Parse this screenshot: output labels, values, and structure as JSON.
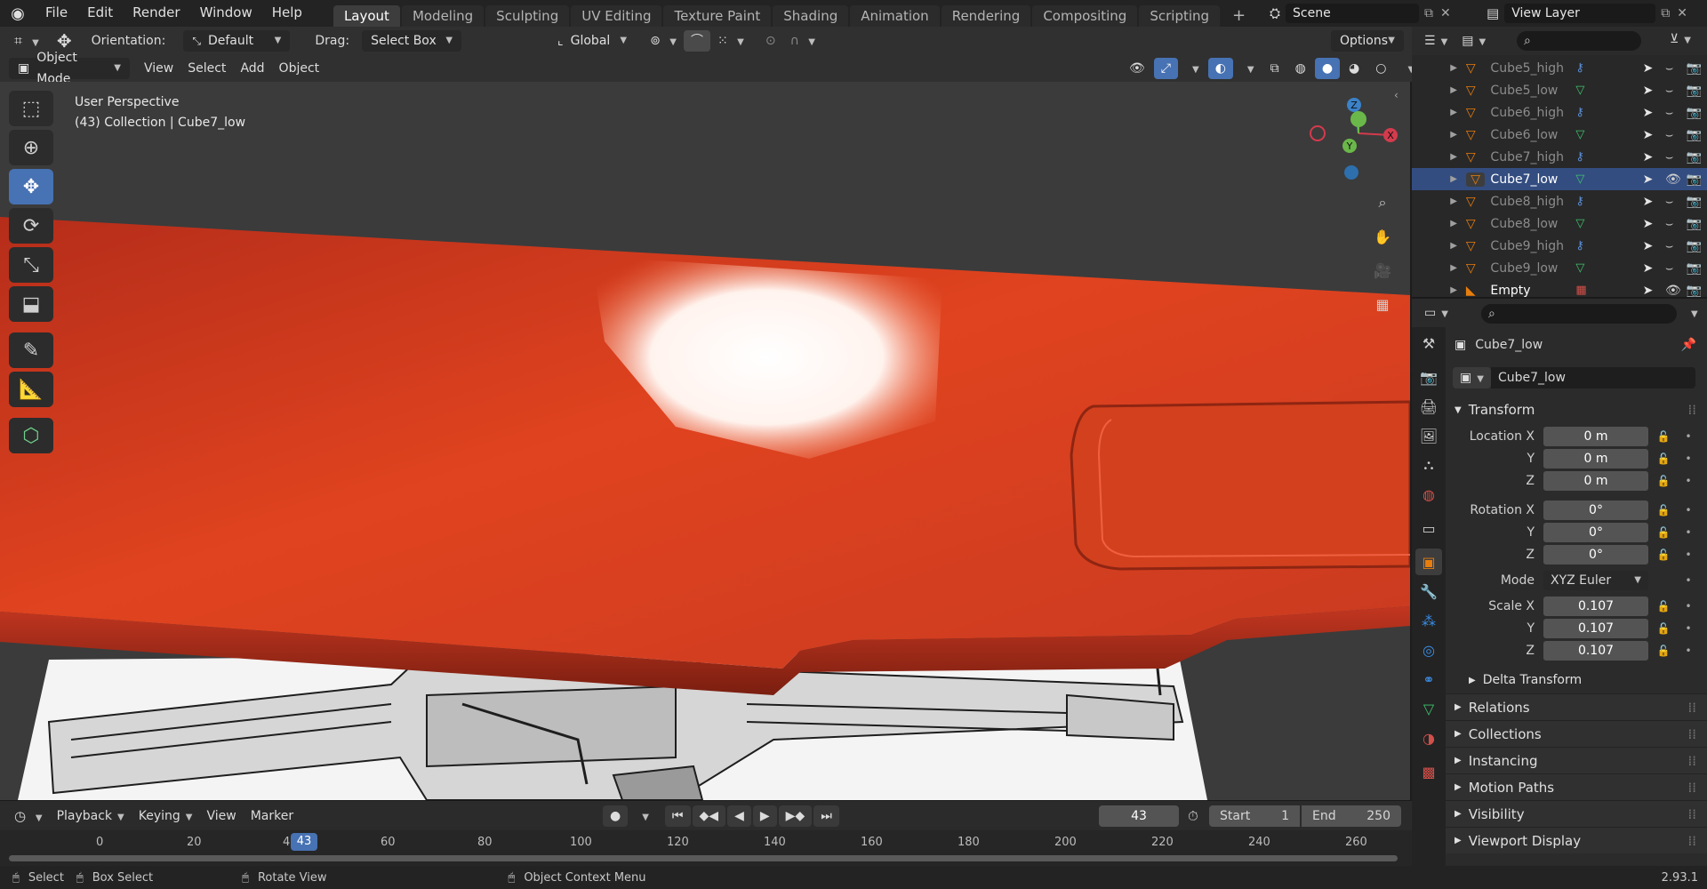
{
  "topbar": {
    "menus": [
      "File",
      "Edit",
      "Render",
      "Window",
      "Help"
    ],
    "workspaces": [
      "Layout",
      "Modeling",
      "Sculpting",
      "UV Editing",
      "Texture Paint",
      "Shading",
      "Animation",
      "Rendering",
      "Compositing",
      "Scripting"
    ],
    "active_workspace": "Layout",
    "add_tab": "+",
    "scene": "Scene",
    "view_layer": "View Layer"
  },
  "viewport_header": {
    "orientation_label": "Orientation:",
    "orientation_value": "Default",
    "drag_label": "Drag:",
    "drag_value": "Select Box",
    "transform_space": "Global",
    "options": "Options",
    "mode": "Object Mode",
    "menus": [
      "View",
      "Select",
      "Add",
      "Object"
    ]
  },
  "viewport": {
    "perspective": "User Perspective",
    "collection_info": "(43) Collection | Cube7_low",
    "gizmo_axes": [
      "Z",
      "Y",
      "X"
    ]
  },
  "timeline": {
    "menus": [
      "Playback",
      "Keying",
      "View",
      "Marker"
    ],
    "current_frame": "43",
    "start_label": "Start",
    "start": "1",
    "end_label": "End",
    "end": "250",
    "ticks": [
      "0",
      "20",
      "4",
      "60",
      "80",
      "100",
      "120",
      "140",
      "160",
      "180",
      "200",
      "220",
      "240",
      "260"
    ],
    "playhead": "43"
  },
  "statusbar": {
    "items": [
      "Select",
      "Box Select",
      "Rotate View",
      "Object Context Menu"
    ],
    "version": "2.93.1"
  },
  "outliner": {
    "rows": [
      {
        "name": "Cube5_high",
        "kind": "high"
      },
      {
        "name": "Cube5_low",
        "kind": "low"
      },
      {
        "name": "Cube6_high",
        "kind": "high"
      },
      {
        "name": "Cube6_low",
        "kind": "low"
      },
      {
        "name": "Cube7_high",
        "kind": "high"
      },
      {
        "name": "Cube7_low",
        "kind": "low",
        "selected": true
      },
      {
        "name": "Cube8_high",
        "kind": "high"
      },
      {
        "name": "Cube8_low",
        "kind": "low"
      },
      {
        "name": "Cube9_high",
        "kind": "high"
      },
      {
        "name": "Cube9_low",
        "kind": "low"
      },
      {
        "name": "Empty",
        "kind": "empty"
      }
    ]
  },
  "properties": {
    "object_name": "Cube7_low",
    "data_name": "Cube7_low",
    "transform_title": "Transform",
    "location_label": "Location X",
    "rotation_label": "Rotation X",
    "scale_label": "Scale X",
    "y_label": "Y",
    "z_label": "Z",
    "location": [
      "0 m",
      "0 m",
      "0 m"
    ],
    "rotation": [
      "0°",
      "0°",
      "0°"
    ],
    "mode_label": "Mode",
    "mode_value": "XYZ Euler",
    "scale": [
      "0.107",
      "0.107",
      "0.107"
    ],
    "delta_transform": "Delta Transform",
    "panels": [
      "Relations",
      "Collections",
      "Instancing",
      "Motion Paths",
      "Visibility",
      "Viewport Display"
    ]
  },
  "colors": {
    "accent": "#4772b3",
    "object_orange": "#e87d0d",
    "mesh_red": "#c8361e"
  }
}
